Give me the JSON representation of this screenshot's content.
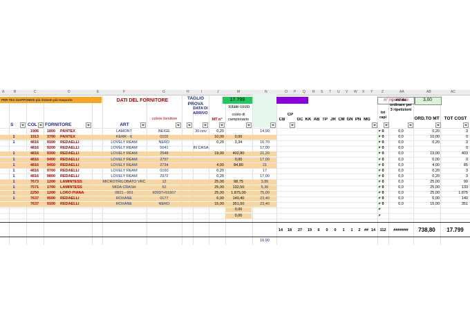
{
  "col_letters": [
    "A",
    "B",
    "C",
    "D",
    "E",
    "F",
    "G",
    "H",
    "I",
    "J",
    "M",
    "N",
    "O",
    "P",
    "Q",
    "R",
    "S",
    "T",
    "U",
    "V",
    "W",
    "X",
    "Y",
    "Z",
    "AA",
    "AB",
    "AC"
  ],
  "top": {
    "left_label": "PER TEX GIAPPONESI  più 3X4mm più trasporto",
    "fornitore_title": "DATI DEL FORNITORE",
    "taglio": "TAGLIO PROVA",
    "total": "17.799",
    "tipologia": "TIPOLOGIA",
    "n_rip_label": "n° ripetizioni",
    "n_rip_value": "3,00"
  },
  "headers": {
    "s": "S",
    "col": "COL",
    "fornitore": "FORNITORE",
    "art": "ART",
    "colore": "colore fornitore",
    "data": "DATA DI ARRIVO",
    "mt": "MT n°",
    "totale_costo": "totale costo",
    "costo_camp": "costo di campionario",
    "cb": "CB",
    "cp": "CP",
    "gc": "GC",
    "kk": "KK",
    "ab": "AB",
    "tp": "TP",
    "jr": "JR",
    "cm": "CM",
    "gn": "GN",
    "pn": "PN",
    "mg": "MG",
    "tot_capi": "tot capi",
    "mt_da_ord": "mt da ordinare per 3 ripetizioni",
    "ord_mt": "ORD.TO MT",
    "tot_cost": "TOT COST"
  },
  "rows": [
    {
      "s": "",
      "col": "1906",
      "num": "1800",
      "forn": "PANTEX",
      "art": "LAMONT",
      "colore": "BEIGE",
      "data": "30-nov",
      "mt": "0,20",
      "costo": "",
      "camp": "14,90",
      "tot": "0",
      "mt_ord": "0,0",
      "ord": "0,20",
      "cost": "3",
      "band": "none"
    },
    {
      "s": "1",
      "col": "1913",
      "num": "3700",
      "forn": "PANTEX",
      "art": "KERR - 6",
      "colore": "0102",
      "data": "",
      "mt": "10,00",
      "costo": "0,00",
      "camp": "",
      "tot": "0",
      "mt_ord": "0,0",
      "ord": "10,00",
      "cost": "0",
      "band": "orange"
    },
    {
      "s": "1",
      "col": "4816",
      "num": "9100",
      "forn": "REDAELLI",
      "art": "LOVELY REAM",
      "colore": "NERO",
      "data": "",
      "mt": "0,20",
      "costo": "3,34",
      "camp": "16,70",
      "tot": "0",
      "mt_ord": "0,0",
      "ord": "0,20",
      "cost": "3",
      "band": "none"
    },
    {
      "s": "",
      "col": "4816",
      "num": "9200",
      "forn": "REDAELLI",
      "art": "LOVELY REAM",
      "colore": "5041",
      "data": "IN CASA",
      "mt": "",
      "costo": "",
      "camp": "17,00",
      "tot": "0",
      "mt_ord": "0,0",
      "ord": "",
      "cost": "0",
      "band": "none"
    },
    {
      "s": "1",
      "col": "4816",
      "num": "9300",
      "forn": "REDAELLI",
      "art": "LOVELY REAM",
      "colore": "2548",
      "data": "",
      "mt": "19,00",
      "costo": "402,80",
      "camp": "21,20",
      "tot": "0",
      "mt_ord": "0,0",
      "ord": "19,00",
      "cost": "403",
      "band": "orange"
    },
    {
      "s": "1",
      "col": "4816",
      "num": "9400",
      "forn": "REDAELLI",
      "art": "LOVELY REAM",
      "colore": "2757",
      "data": "",
      "mt": "",
      "costo": "0,00",
      "camp": "17,00",
      "tot": "0",
      "mt_ord": "0,0",
      "ord": "0,00",
      "cost": "0",
      "band": "orange"
    },
    {
      "s": "1",
      "col": "4816",
      "num": "9450",
      "forn": "REDAELLI",
      "art": "LOVELY REAM",
      "colore": "2734",
      "data": "",
      "mt": "4,00",
      "costo": "84,80",
      "camp": "21",
      "tot": "0",
      "mt_ord": "0,0",
      "ord": "4,00",
      "cost": "85",
      "band": "orange"
    },
    {
      "s": "1",
      "col": "4816",
      "num": "9700",
      "forn": "REDAELLI",
      "art": "LOVELY REAM",
      "colore": "0160",
      "data": "",
      "mt": "0,20",
      "costo": "",
      "camp": "17",
      "tot": "0",
      "mt_ord": "0,0",
      "ord": "0,20",
      "cost": "3",
      "band": "none"
    },
    {
      "s": "1",
      "col": "4816",
      "num": "9800",
      "forn": "REDAELLI",
      "art": "LOVELY REAM",
      "colore": "2972",
      "data": "",
      "mt": "0,20",
      "costo": "",
      "camp": "17,00",
      "tot": "0",
      "mt_ord": "0,0",
      "ord": "0,20",
      "cost": "3",
      "band": "none"
    },
    {
      "s": "1",
      "col": "7673",
      "num": "1200",
      "forn": "LAMINTESS",
      "art": "MICROTRILOBATO VRC",
      "colore": "12",
      "data": "",
      "mt": "25,00",
      "costo": "98,75",
      "camp": "3,95",
      "tot": "0",
      "mt_ord": "0,0",
      "ord": "25,00",
      "cost": "99",
      "band": "orange"
    },
    {
      "s": "1",
      "col": "7571",
      "num": "1700",
      "forn": "LAMINTESS",
      "art": "MIDA CRASH",
      "colore": "52",
      "data": "",
      "mt": "25,00",
      "costo": "132,50",
      "camp": "5,30",
      "tot": "0",
      "mt_ord": "0,0",
      "ord": "25,00",
      "cost": "133",
      "band": "orange"
    },
    {
      "s": "1",
      "col": "2250",
      "num": "1200",
      "forn": "LORO PIANA",
      "art": "0821 - 001",
      "colore": "60037+51607",
      "data": "",
      "mt": "25,00",
      "costo": "1.875,00",
      "camp": "75,00",
      "tot": "0",
      "mt_ord": "0,0",
      "ord": "25,00",
      "cost": "1.875",
      "band": "orange"
    },
    {
      "s": "1",
      "col": "7637",
      "num": "9500",
      "forn": "REDAELLI",
      "art": "ROXANE",
      "colore": "0177",
      "data": "",
      "mt": "6,00",
      "costo": "140,40",
      "camp": "23,40",
      "tot": "0",
      "mt_ord": "0,0",
      "ord": "6,00",
      "cost": "140",
      "band": "orange"
    },
    {
      "s": "",
      "col": "7637",
      "num": "9100",
      "forn": "REDAELLI",
      "art": "ROXANE",
      "colore": "NERO",
      "data": "",
      "mt": "15,00",
      "costo": "351,00",
      "camp": "23,40",
      "tot": "0",
      "mt_ord": "0,0",
      "ord": "15,00",
      "cost": "351",
      "band": "orange"
    },
    {
      "s": "",
      "col": "",
      "num": "",
      "forn": "",
      "art": "",
      "colore": "",
      "data": "",
      "mt": "",
      "costo": "0,00",
      "camp": "",
      "tot": "",
      "mt_ord": "",
      "ord": "",
      "cost": "",
      "band": "orange_small"
    },
    {
      "s": "",
      "col": "",
      "num": "",
      "forn": "",
      "art": "",
      "colore": "",
      "data": "",
      "mt": "",
      "costo": "0,00",
      "camp": "",
      "tot": "",
      "mt_ord": "",
      "ord": "",
      "cost": "",
      "band": "orange_small"
    }
  ],
  "totals": {
    "cb": "14",
    "cp": "18",
    "gc": "27",
    "kk": "19",
    "ab": "6",
    "tp": "0",
    "jr": "0",
    "cm": "1",
    "gn": "1",
    "pn": "2",
    "mg": "##",
    "x": "14",
    "tot_capi": "112",
    "mt_ord": "#######",
    "ord": "738,80",
    "cost": "17.799"
  },
  "bottom_value": "16,90"
}
